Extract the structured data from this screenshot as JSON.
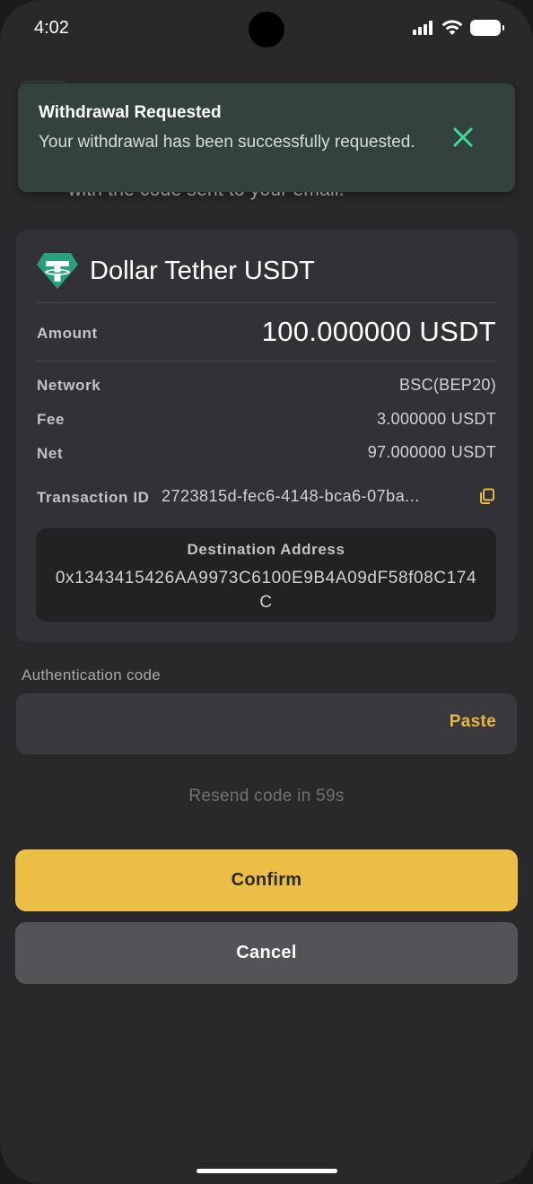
{
  "status_bar": {
    "time": "4:02"
  },
  "header": {
    "subtitle_partial": "with the code sent to your email."
  },
  "toast": {
    "title": "Withdrawal Requested",
    "message": "Your withdrawal has been successfully requested.",
    "close_icon": "close-icon",
    "accent_color": "#3ddc97"
  },
  "withdrawal": {
    "coin_icon": "tether-icon",
    "coin_title": "Dollar Tether USDT",
    "amount_label": "Amount",
    "amount_value": "100.000000 USDT",
    "network_label": "Network",
    "network_value": "BSC(BEP20)",
    "fee_label": "Fee",
    "fee_value": "3.000000 USDT",
    "net_label": "Net",
    "net_value": "97.000000 USDT",
    "txid_label": "Transaction ID",
    "txid_value": "2723815d-fec6-4148-bca6-07ba...",
    "copy_icon": "copy-icon",
    "destination_label": "Destination Address",
    "destination_value": "0x1343415426AA9973C6100E9B4A09dF58f08C174C"
  },
  "auth": {
    "label": "Authentication code",
    "value": "",
    "paste_label": "Paste",
    "resend_text": "Resend code in 59s"
  },
  "actions": {
    "confirm_label": "Confirm",
    "cancel_label": "Cancel",
    "brand_color": "#ebbe45"
  }
}
